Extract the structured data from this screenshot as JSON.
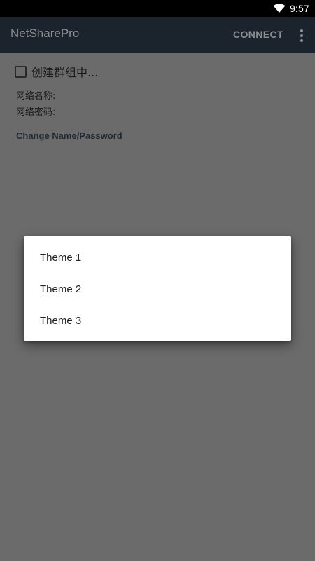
{
  "status_bar": {
    "time": "9:57",
    "icons": [
      "wifi-icon"
    ]
  },
  "app_bar": {
    "title": "NetSharePro",
    "connect_label": "CONNECT",
    "overflow_icon": "more-vert-icon"
  },
  "main": {
    "checkbox": {
      "label": "创建群组中...",
      "checked": false
    },
    "network_name_label": "网络名称:",
    "network_password_label": "网络密码:",
    "change_link": "Change Name/Password"
  },
  "dialog": {
    "items": [
      {
        "label": "Theme 1"
      },
      {
        "label": "Theme 2"
      },
      {
        "label": "Theme 3"
      }
    ]
  },
  "colors": {
    "app_bar": "#1b232c",
    "scrim": "#6b6b6b",
    "status_bar": "#000000",
    "dialog": "#ffffff"
  }
}
